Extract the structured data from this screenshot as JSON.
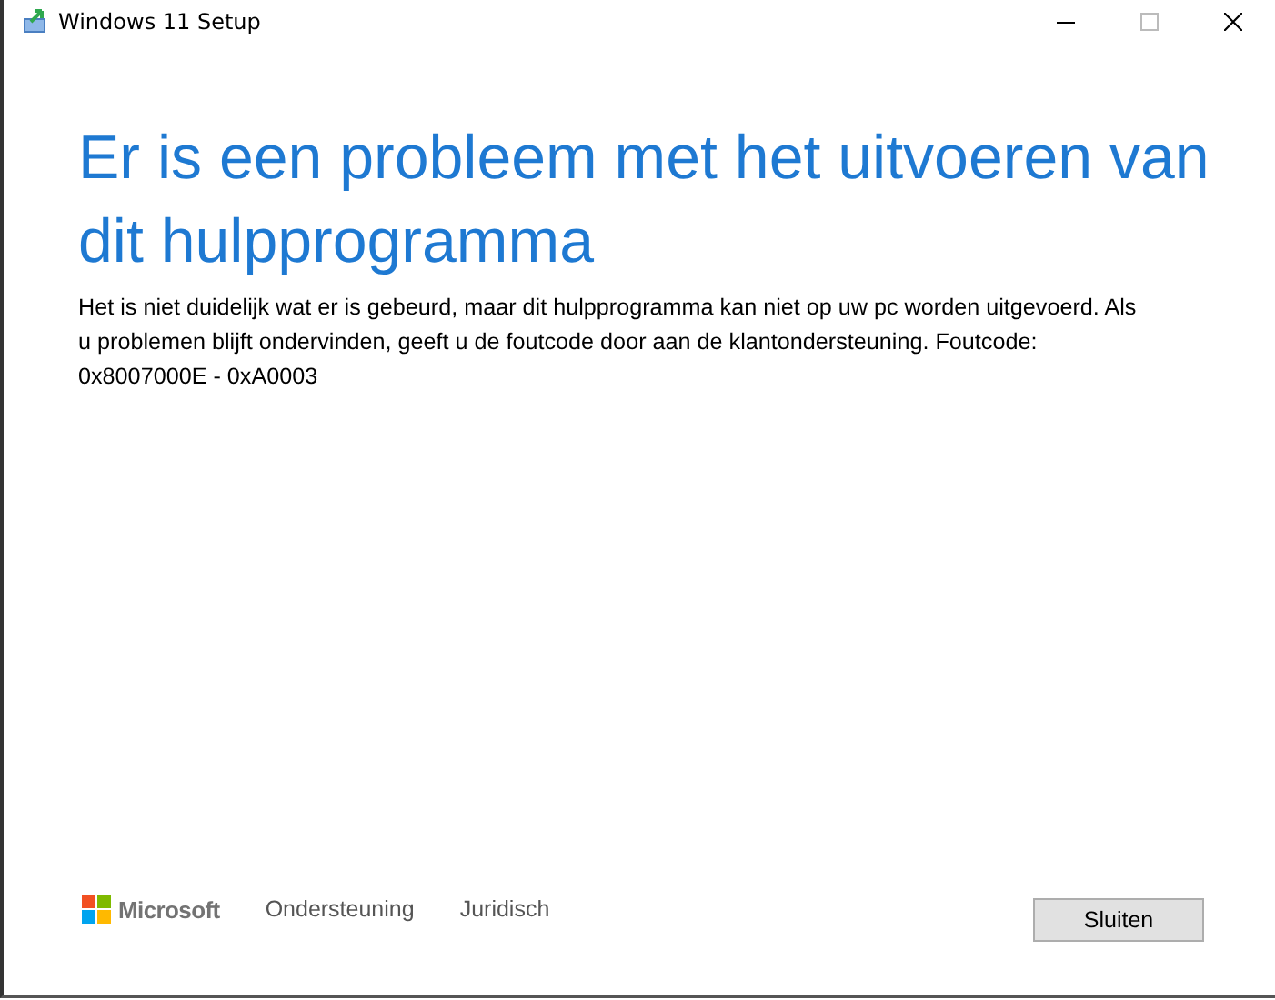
{
  "window": {
    "title": "Windows 11 Setup"
  },
  "heading": "Er is een probleem met het uitvoeren van dit hulpprogramma",
  "message": "Het is niet duidelijk wat er is gebeurd, maar dit hulpprogramma kan niet op uw pc worden uitgevoerd. Als u problemen blijft ondervinden, geeft u de foutcode door aan de klantondersteuning. Foutcode: 0x8007000E - 0xA0003",
  "footer": {
    "brand": "Microsoft",
    "links": [
      "Ondersteuning",
      "Juridisch"
    ],
    "button": "Sluiten"
  }
}
